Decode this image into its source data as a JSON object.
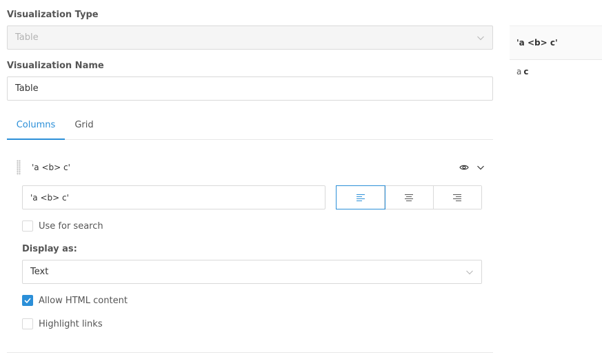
{
  "viz_type": {
    "label": "Visualization Type",
    "value": "Table"
  },
  "viz_name": {
    "label": "Visualization Name",
    "value": "Table"
  },
  "tabs": [
    {
      "label": "Columns",
      "active": true
    },
    {
      "label": "Grid",
      "active": false
    }
  ],
  "column": {
    "title": "'a <b> c'",
    "name_value": "'a <b> c'",
    "alignment": "left",
    "use_for_search": {
      "label": "Use for search",
      "checked": false
    },
    "display_as": {
      "label": "Display as:",
      "value": "Text"
    },
    "allow_html": {
      "label": "Allow HTML content",
      "checked": true
    },
    "highlight_links": {
      "label": "Highlight links",
      "checked": false
    }
  },
  "preview": {
    "header": "'a <b> c'",
    "cell_plain_a": "a",
    "cell_bold": "c"
  },
  "colors": {
    "accent": "#2b8fd8",
    "border": "#d9d9d9"
  },
  "icons": [
    "chevron-down-icon",
    "eye-icon",
    "drag-handle-icon",
    "align-left-icon",
    "align-center-icon",
    "align-right-icon",
    "checkmark-icon"
  ]
}
